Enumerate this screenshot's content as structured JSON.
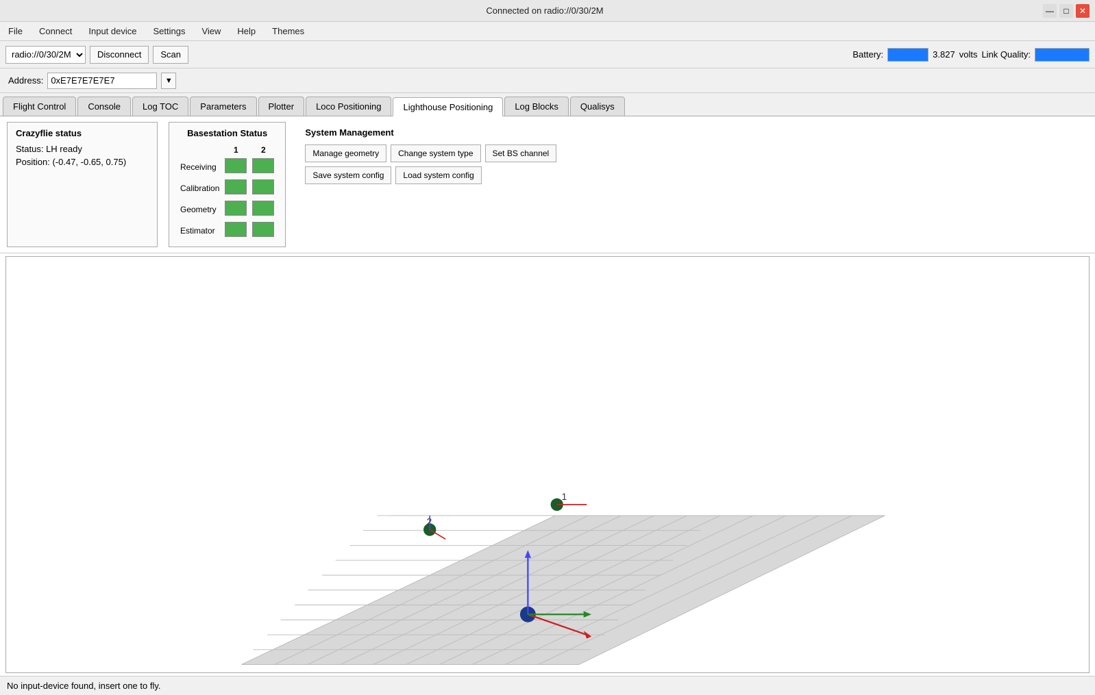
{
  "titlebar": {
    "title": "Connected on radio://0/30/2M",
    "min_label": "—",
    "max_label": "□",
    "close_label": "✕"
  },
  "menubar": {
    "items": [
      "File",
      "Connect",
      "Input device",
      "Settings",
      "View",
      "Help",
      "Themes"
    ]
  },
  "toolbar": {
    "radio_value": "radio://0/30/2M",
    "disconnect_label": "Disconnect",
    "scan_label": "Scan",
    "battery_label": "Battery:",
    "battery_value": "3.827",
    "volts_label": "volts",
    "link_quality_label": "Link Quality:"
  },
  "addressbar": {
    "label": "Address:",
    "value": "0xE7E7E7E7E7"
  },
  "tabs": {
    "items": [
      {
        "label": "Flight Control",
        "active": false
      },
      {
        "label": "Console",
        "active": false
      },
      {
        "label": "Log TOC",
        "active": false
      },
      {
        "label": "Parameters",
        "active": false
      },
      {
        "label": "Plotter",
        "active": false
      },
      {
        "label": "Loco Positioning",
        "active": false
      },
      {
        "label": "Lighthouse Positioning",
        "active": true
      },
      {
        "label": "Log Blocks",
        "active": false
      },
      {
        "label": "Qualisys",
        "active": false
      }
    ]
  },
  "cf_status": {
    "title": "Crazyflie status",
    "status_label": "Status: LH ready",
    "position_label": "Position: (-0.47, -0.65, 0.75)"
  },
  "bs_status": {
    "title": "Basestation Status",
    "col1": "1",
    "col2": "2",
    "rows": [
      {
        "label": "Receiving"
      },
      {
        "label": "Calibration"
      },
      {
        "label": "Geometry"
      },
      {
        "label": "Estimator"
      }
    ]
  },
  "sys_mgmt": {
    "title": "System Management",
    "btn1": "Manage geometry",
    "btn2": "Change system type",
    "btn3": "Set BS channel",
    "btn4": "Save system config",
    "btn5": "Load system config"
  },
  "statusbar": {
    "text": "No input-device found, insert one to fly."
  }
}
